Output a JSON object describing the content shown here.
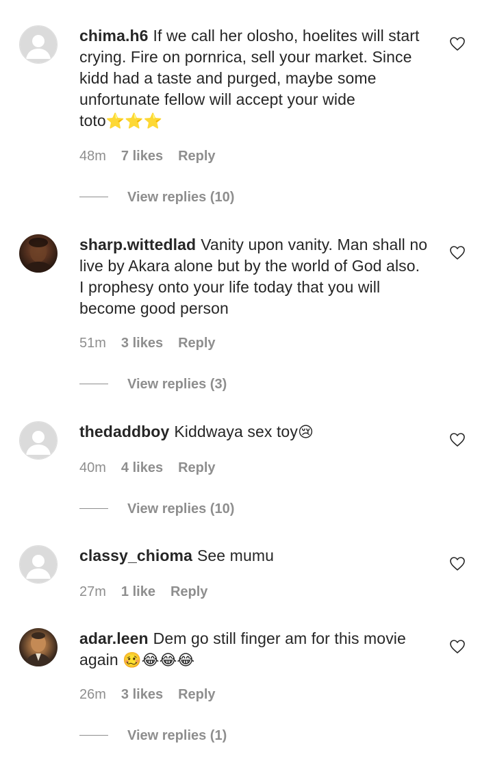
{
  "comments": [
    {
      "username": "chima.h6",
      "text": "If we call her olosho, hoelites will start crying. Fire on pornrica, sell your market. Since kidd had a taste and purged, maybe some unfortunate fellow will accept your wide toto",
      "emoji": "⭐⭐⭐",
      "time": "48m",
      "likes": "7 likes",
      "reply": "Reply",
      "view_replies": "View replies (10)",
      "avatar": "default-avatar"
    },
    {
      "username": "sharp.wittedlad",
      "text": "Vanity upon vanity. Man shall no live by Akara alone but by the world of God also. I prophesy onto your life today that you will become good person",
      "emoji": "",
      "time": "51m",
      "likes": "3 likes",
      "reply": "Reply",
      "view_replies": "View replies (3)",
      "avatar": "photo-avatar"
    },
    {
      "username": "thedaddboy",
      "text": "Kiddwaya sex toy",
      "emoji": "😢",
      "time": "40m",
      "likes": "4 likes",
      "reply": "Reply",
      "view_replies": "View replies (10)",
      "avatar": "default-avatar"
    },
    {
      "username": "classy_chioma",
      "text": "See mumu",
      "emoji": "",
      "time": "27m",
      "likes": "1 like",
      "reply": "Reply",
      "avatar": "default-avatar"
    },
    {
      "username": "adar.leen",
      "text": "Dem go still finger am for this movie again",
      "emoji": "🥴😂😂😂",
      "time": "26m",
      "likes": "3 likes",
      "reply": "Reply",
      "view_replies": "View replies (1)",
      "avatar": "photo-avatar"
    }
  ],
  "icons": {
    "like": "heart-outline-icon",
    "avatar_placeholder": "person-silhouette-icon"
  },
  "colors": {
    "text": "#262626",
    "secondary": "#8e8e8e",
    "placeholder_bg": "#dbdbdb"
  }
}
